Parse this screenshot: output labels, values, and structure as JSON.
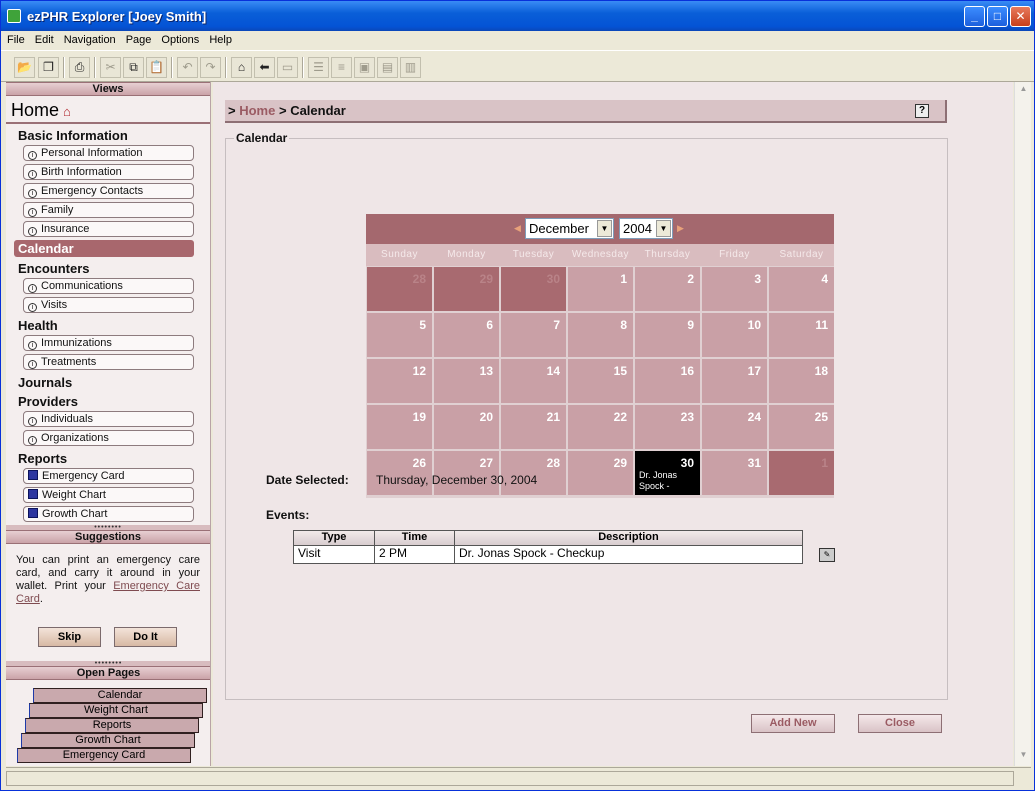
{
  "window": {
    "title": "ezPHR Explorer [Joey Smith]"
  },
  "menu": [
    "File",
    "Edit",
    "Navigation",
    "Page",
    "Options",
    "Help"
  ],
  "views": {
    "header": "Views",
    "home_label": "Home",
    "sections": [
      {
        "label": "Basic Information",
        "items": [
          "Personal Information",
          "Birth Information",
          "Emergency Contacts",
          "Family",
          "Insurance"
        ]
      },
      {
        "label": "Calendar",
        "active": true,
        "items": []
      },
      {
        "label": "Encounters",
        "items": [
          "Communications",
          "Visits"
        ]
      },
      {
        "label": "Health",
        "items": [
          "Immunizations",
          "Treatments"
        ]
      },
      {
        "label": "Journals",
        "items": []
      },
      {
        "label": "Providers",
        "items": [
          "Individuals",
          "Organizations"
        ]
      },
      {
        "label": "Reports",
        "items": [
          "Emergency Card",
          "Weight Chart",
          "Growth Chart"
        ]
      }
    ]
  },
  "suggestions": {
    "header": "Suggestions",
    "text": "You can print an emergency care card, and carry it around in your wallet. Print your ",
    "link": "Emergency Care Card",
    "tail": ".",
    "skip": "Skip",
    "doit": "Do It"
  },
  "open_pages": {
    "header": "Open Pages",
    "items": [
      "Calendar",
      "Weight Chart",
      "Reports",
      "Growth Chart",
      "Emergency Card"
    ]
  },
  "breadcrumb": {
    "prefix": ">",
    "home": "Home",
    "sep": ">",
    "current": "Calendar",
    "help": "?"
  },
  "calendar": {
    "legend": "Calendar",
    "month": "December",
    "year": "2004",
    "days_of_week": [
      "Sunday",
      "Monday",
      "Tuesday",
      "Wednesday",
      "Thursday",
      "Friday",
      "Saturday"
    ],
    "weeks": [
      [
        "28",
        "29",
        "30",
        "1",
        "2",
        "3",
        "4"
      ],
      [
        "5",
        "6",
        "7",
        "8",
        "9",
        "10",
        "11"
      ],
      [
        "12",
        "13",
        "14",
        "15",
        "16",
        "17",
        "18"
      ],
      [
        "19",
        "20",
        "21",
        "22",
        "23",
        "24",
        "25"
      ],
      [
        "26",
        "27",
        "28",
        "29",
        "30",
        "31",
        "1"
      ]
    ],
    "other_month_cells": [
      [
        0,
        0
      ],
      [
        0,
        1
      ],
      [
        0,
        2
      ],
      [
        4,
        6
      ]
    ],
    "selected_cell": [
      4,
      4
    ],
    "selected_event_text": "Dr. Jonas Spock -"
  },
  "selection": {
    "label": "Date Selected:",
    "value": "Thursday, December 30, 2004"
  },
  "events": {
    "label": "Events:",
    "columns": [
      "Type",
      "Time",
      "Description"
    ],
    "rows": [
      {
        "type": "Visit",
        "time": "2 PM",
        "description": "Dr. Jonas Spock - Checkup"
      }
    ]
  },
  "buttons": {
    "add_new": "Add New",
    "close": "Close"
  }
}
